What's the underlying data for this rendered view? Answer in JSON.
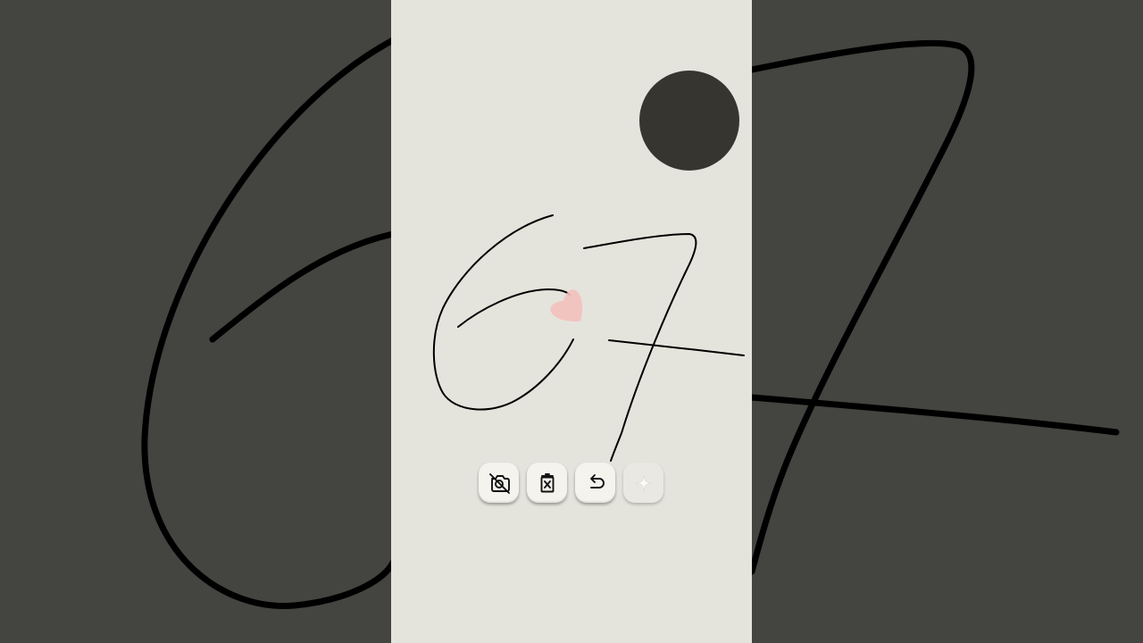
{
  "app": {
    "background_color": "#444440",
    "canvas_color": "#e5e4dc",
    "ink_color": "#000000"
  },
  "color_picker": {
    "selected_color": "#363530",
    "icon": "color-swatch"
  },
  "brush_cursor": {
    "color": "#f3c0bc",
    "shape": "heart-icon"
  },
  "toolbar": {
    "buttons": [
      {
        "name": "camera-off",
        "icon": "camera-off-icon",
        "enabled": true
      },
      {
        "name": "clear-canvas",
        "icon": "trash-x-icon",
        "enabled": true
      },
      {
        "name": "undo",
        "icon": "undo-icon",
        "enabled": true
      },
      {
        "name": "sparkle",
        "icon": "sparkle-icon",
        "enabled": false
      }
    ]
  }
}
